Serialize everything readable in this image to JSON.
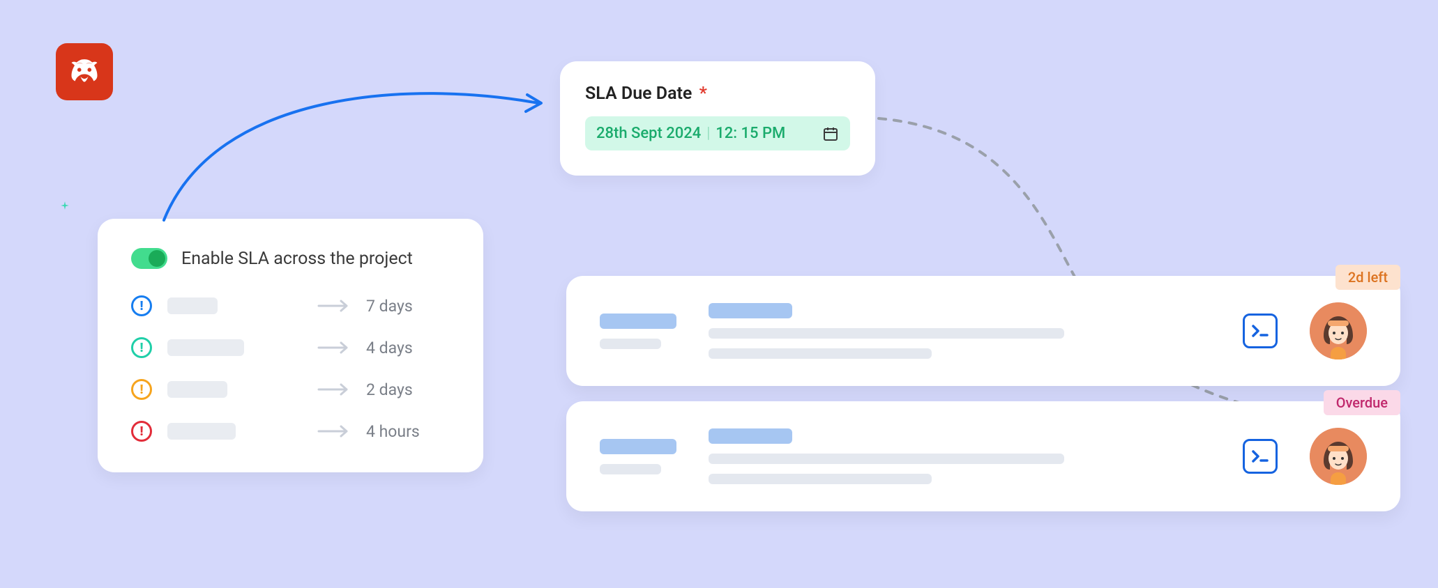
{
  "logo": {
    "name": "brand-logo"
  },
  "settings": {
    "toggle_on": true,
    "title": "Enable SLA across the project",
    "rows": [
      {
        "priority": "blue",
        "value": "7 days"
      },
      {
        "priority": "teal",
        "value": "4 days"
      },
      {
        "priority": "orange",
        "value": "2 days"
      },
      {
        "priority": "red",
        "value": "4 hours"
      }
    ]
  },
  "due": {
    "label": "SLA Due Date",
    "required": "*",
    "date": "28th Sept 2024",
    "time": "12: 15 PM"
  },
  "tasks": [
    {
      "badge": "2d left",
      "badge_type": "left"
    },
    {
      "badge": "Overdue",
      "badge_type": "overdue"
    }
  ],
  "colors": {
    "bg": "#d4d8fb",
    "brand": "#d8361a",
    "arrow_blue": "#1872f0",
    "arrow_grey": "#9aa0aa"
  }
}
